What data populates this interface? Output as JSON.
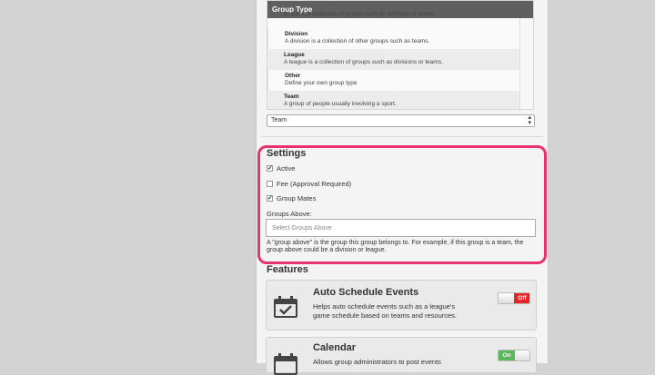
{
  "group_type": {
    "header": "Group Type",
    "rows": [
      {
        "name": "",
        "desc": "A club is a collection of groups such as divisions or teams."
      },
      {
        "name": "Division",
        "desc": "A division is a collection of other groups such as teams."
      },
      {
        "name": "League",
        "desc": "A league is a collection of groups such as divisions or teams."
      },
      {
        "name": "Other",
        "desc": "Define your own group type"
      },
      {
        "name": "Team",
        "desc": "A group of people usually involving a sport."
      }
    ],
    "selected": "Team"
  },
  "settings": {
    "title": "Settings",
    "checkboxes": [
      {
        "label": "Active",
        "checked": true
      },
      {
        "label": "Fee (Approval Required)",
        "checked": false
      },
      {
        "label": "Group Mates",
        "checked": true
      }
    ],
    "groups_above_label": "Groups Above:",
    "groups_above_placeholder": "Select Groups Above",
    "help": "A \"group above\" is the group this group belongs to. For example, if this group is a team, the group above could be a division or league.",
    "highlight_color": "#e8336d"
  },
  "features": {
    "title": "Features",
    "items": [
      {
        "title": "Auto Schedule Events",
        "desc": "Helps auto schedule events such as a league's game schedule based on teams and resources.",
        "toggle": "Off",
        "icon": "calendar-check-icon"
      },
      {
        "title": "Calendar",
        "desc": "Allows group administrators to post events",
        "toggle": "On",
        "icon": "calendar-icon"
      }
    ]
  }
}
